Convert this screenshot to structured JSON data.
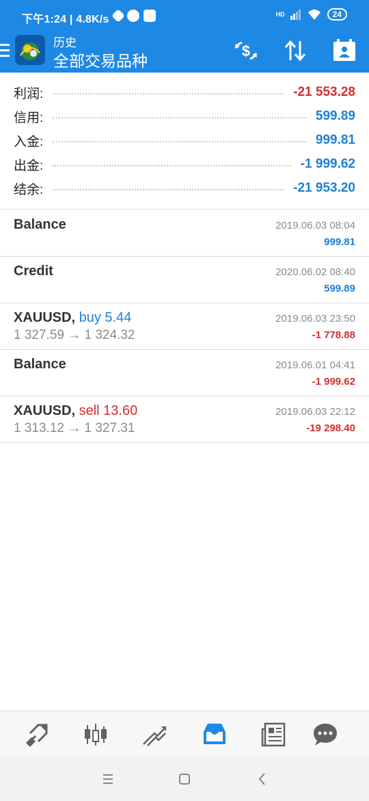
{
  "status": {
    "time_speed": "下午1:24 | 4.8K/s",
    "hd": "HD",
    "battery": "24"
  },
  "header": {
    "section": "历史",
    "title": "全部交易品种",
    "icons": [
      "menu-icon",
      "app-logo",
      "currency-exchange-icon",
      "sort-icon",
      "report-icon"
    ]
  },
  "summary": [
    {
      "label": "利润:",
      "value": "-21 553.28",
      "sign": "negative"
    },
    {
      "label": "信用:",
      "value": "599.89",
      "sign": "positive"
    },
    {
      "label": "入金:",
      "value": "999.81",
      "sign": "positive"
    },
    {
      "label": "出金:",
      "value": "-1 999.62",
      "sign": "positive"
    },
    {
      "label": "结余:",
      "value": "-21 953.20",
      "sign": "positive"
    }
  ],
  "deals": [
    {
      "title": "Balance",
      "time": "2019.06.03 08:04",
      "amount": "999.81",
      "sign": "positive"
    },
    {
      "title": "Credit",
      "time": "2020.06.02 08:40",
      "amount": "599.89",
      "sign": "positive"
    },
    {
      "symbol": "XAUUSD,",
      "op": "buy 5.44",
      "op_color": "blue",
      "prices": "1 327.59 → 1 324.32",
      "time": "2019.06.03 23:50",
      "amount": "-1 778.88",
      "sign": "negative"
    },
    {
      "title": "Balance",
      "time": "2019.06.01 04:41",
      "amount": "-1 999.62",
      "sign": "negative"
    },
    {
      "symbol": "XAUUSD,",
      "op": "sell 13.60",
      "op_color": "red",
      "prices": "1 313.12 → 1 327.31",
      "time": "2019.06.03 22:12",
      "amount": "-19 298.40",
      "sign": "negative"
    }
  ],
  "bottom_nav": [
    "quotes-icon",
    "chart-icon",
    "trade-icon",
    "history-icon",
    "news-icon",
    "chat-icon"
  ],
  "system_nav": [
    "recents-icon",
    "home-icon",
    "back-icon"
  ],
  "colors": {
    "primary": "#1e88e5",
    "positive": "#1e7fd6",
    "negative": "#d32f2f",
    "active_tab": "#1e88e5",
    "inactive_tab": "#616161"
  }
}
